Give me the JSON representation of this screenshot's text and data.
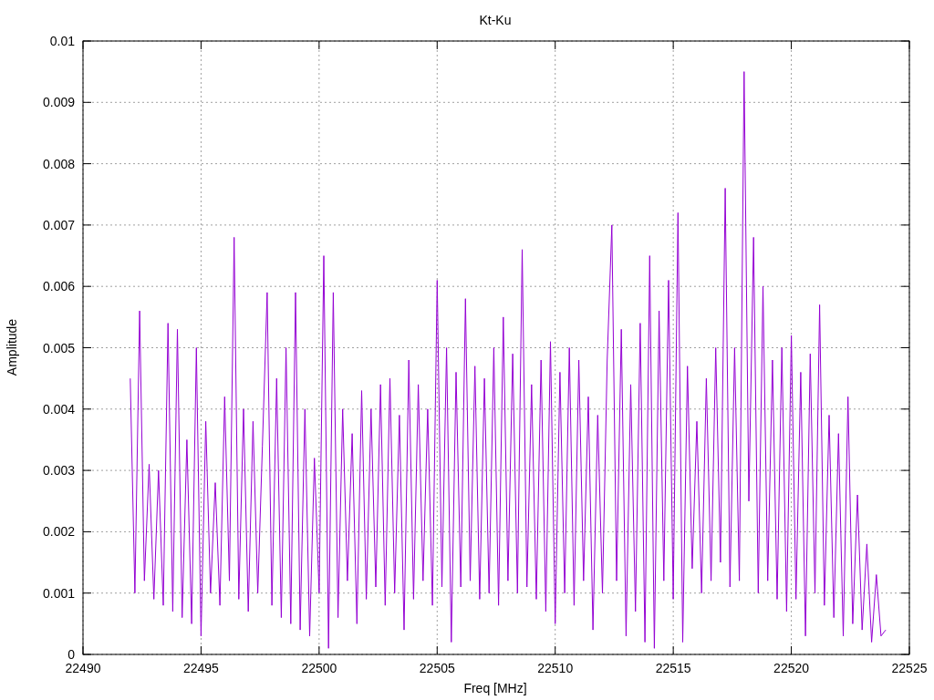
{
  "chart_data": {
    "type": "line",
    "title": "Kt-Ku",
    "xlabel": "Freq [MHz]",
    "ylabel": "Amplitude",
    "xlim": [
      22490,
      22525
    ],
    "ylim": [
      0,
      0.01
    ],
    "grid": true,
    "xticks": [
      22490,
      22495,
      22500,
      22505,
      22510,
      22515,
      22520,
      22525
    ],
    "yticks": [
      0,
      0.001,
      0.002,
      0.003,
      0.004,
      0.005,
      0.006,
      0.007,
      0.008,
      0.009,
      0.01
    ],
    "x": [
      22492,
      22492.2,
      22492.4,
      22492.6,
      22492.8,
      22493,
      22493.2,
      22493.4,
      22493.6,
      22493.8,
      22494,
      22494.2,
      22494.4,
      22494.6,
      22494.8,
      22495,
      22495.2,
      22495.4,
      22495.6,
      22495.8,
      22496,
      22496.2,
      22496.4,
      22496.6,
      22496.8,
      22497,
      22497.2,
      22497.4,
      22497.6,
      22497.8,
      22498,
      22498.2,
      22498.4,
      22498.6,
      22498.8,
      22499,
      22499.2,
      22499.4,
      22499.6,
      22499.8,
      22500,
      22500.2,
      22500.4,
      22500.6,
      22500.8,
      22501,
      22501.2,
      22501.4,
      22501.6,
      22501.8,
      22502,
      22502.2,
      22502.4,
      22502.6,
      22502.8,
      22503,
      22503.2,
      22503.4,
      22503.6,
      22503.8,
      22504,
      22504.2,
      22504.4,
      22504.6,
      22504.8,
      22505,
      22505.2,
      22505.4,
      22505.6,
      22505.8,
      22506,
      22506.2,
      22506.4,
      22506.6,
      22506.8,
      22507,
      22507.2,
      22507.4,
      22507.6,
      22507.8,
      22508,
      22508.2,
      22508.4,
      22508.6,
      22508.8,
      22509,
      22509.2,
      22509.4,
      22509.6,
      22509.8,
      22510,
      22510.2,
      22510.4,
      22510.6,
      22510.8,
      22511,
      22511.2,
      22511.4,
      22511.6,
      22511.8,
      22512,
      22512.2,
      22512.4,
      22512.6,
      22512.8,
      22513,
      22513.2,
      22513.4,
      22513.6,
      22513.8,
      22514,
      22514.2,
      22514.4,
      22514.6,
      22514.8,
      22515,
      22515.2,
      22515.4,
      22515.6,
      22515.8,
      22516,
      22516.2,
      22516.4,
      22516.6,
      22516.8,
      22517,
      22517.2,
      22517.4,
      22517.6,
      22517.8,
      22518,
      22518.2,
      22518.4,
      22518.6,
      22518.8,
      22519,
      22519.2,
      22519.4,
      22519.6,
      22519.8,
      22520,
      22520.2,
      22520.4,
      22520.6,
      22520.8,
      22521,
      22521.2,
      22521.4,
      22521.6,
      22521.8,
      22522,
      22522.2,
      22522.4,
      22522.6,
      22522.8,
      22523,
      22523.2,
      22523.4,
      22523.6,
      22523.8,
      22524
    ],
    "series": [
      {
        "color": "#9400d3",
        "values": [
          0.0045,
          0.001,
          0.0056,
          0.0012,
          0.0031,
          0.0009,
          0.003,
          0.0008,
          0.0054,
          0.0007,
          0.0053,
          0.0006,
          0.0035,
          0.0005,
          0.005,
          0.0003,
          0.0038,
          0.001,
          0.0028,
          0.0008,
          0.0042,
          0.0012,
          0.0068,
          0.0009,
          0.004,
          0.0007,
          0.0038,
          0.001,
          0.0034,
          0.0059,
          0.0008,
          0.0045,
          0.0006,
          0.005,
          0.0005,
          0.0059,
          0.0004,
          0.004,
          0.0003,
          0.0032,
          0.001,
          0.0065,
          0.0001,
          0.0059,
          0.0006,
          0.004,
          0.0012,
          0.0036,
          0.0005,
          0.0043,
          0.0009,
          0.004,
          0.0011,
          0.0044,
          0.0008,
          0.0045,
          0.001,
          0.0039,
          0.0004,
          0.0048,
          0.0009,
          0.0044,
          0.0012,
          0.004,
          0.0008,
          0.0061,
          0.0011,
          0.005,
          0.0002,
          0.0046,
          0.0011,
          0.0058,
          0.0012,
          0.0047,
          0.0009,
          0.0045,
          0.001,
          0.005,
          0.0008,
          0.0055,
          0.0012,
          0.0049,
          0.001,
          0.0066,
          0.0011,
          0.0044,
          0.0009,
          0.0048,
          0.0007,
          0.0051,
          0.0005,
          0.0046,
          0.001,
          0.005,
          0.0008,
          0.0048,
          0.0012,
          0.0042,
          0.0004,
          0.0039,
          0.001,
          0.0048,
          0.007,
          0.0012,
          0.0053,
          0.0003,
          0.0044,
          0.0007,
          0.0054,
          0.0002,
          0.0065,
          0.0001,
          0.0056,
          0.0012,
          0.0061,
          0.0009,
          0.0072,
          0.0002,
          0.0047,
          0.0014,
          0.0038,
          0.001,
          0.0045,
          0.0012,
          0.005,
          0.0015,
          0.0076,
          0.0011,
          0.005,
          0.0012,
          0.0095,
          0.0025,
          0.0068,
          0.001,
          0.006,
          0.0012,
          0.0048,
          0.0009,
          0.005,
          0.0007,
          0.0052,
          0.0009,
          0.0046,
          0.0003,
          0.0049,
          0.001,
          0.0057,
          0.0008,
          0.0039,
          0.0006,
          0.0036,
          0.0003,
          0.0042,
          0.0005,
          0.0026,
          0.0004,
          0.0018,
          0.0002,
          0.0013,
          0.0003,
          0.0004
        ]
      }
    ]
  }
}
